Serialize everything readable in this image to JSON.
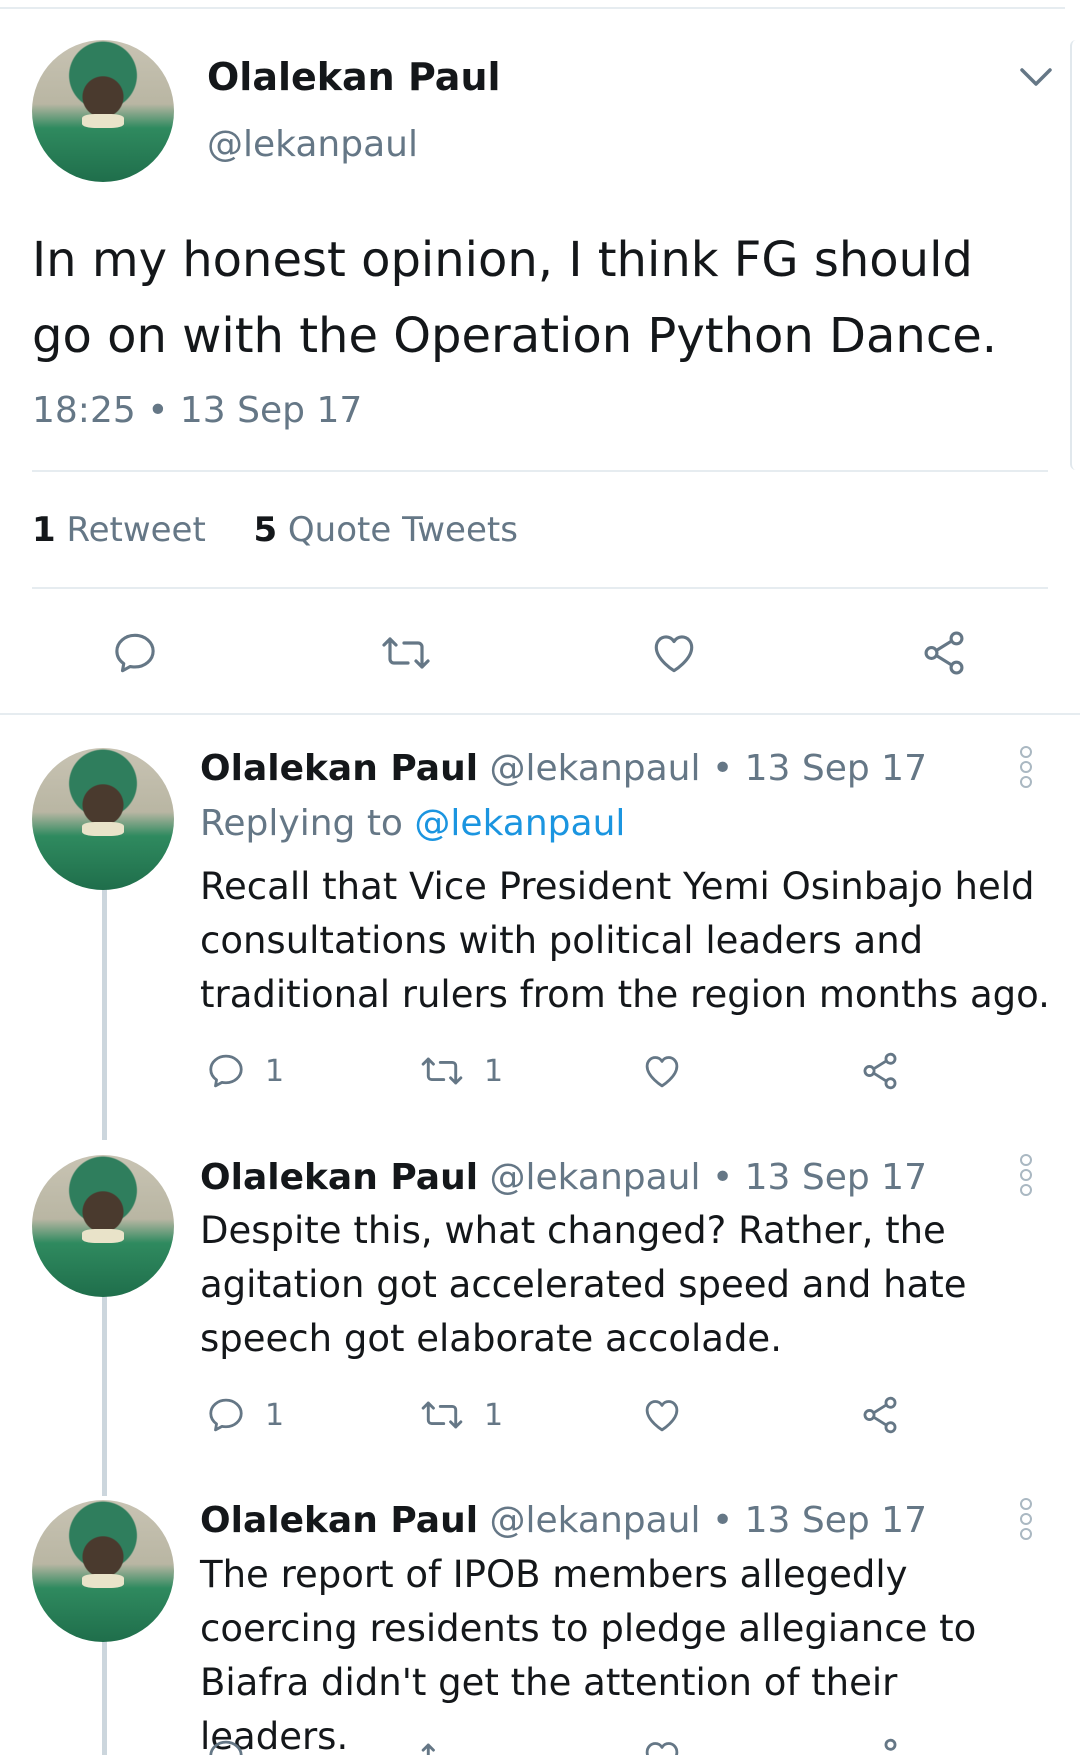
{
  "main_tweet": {
    "author_name": "Olalekan Paul",
    "handle": "@lekanpaul",
    "text": "In my honest opinion, I think FG should go on with the Operation Python Dance.",
    "time": "18:25",
    "date": "13 Sep 17",
    "separator": "•",
    "retweets_count": "1",
    "retweets_label": "Retweet",
    "quotes_count": "5",
    "quotes_label": "Quote Tweets",
    "icons": [
      "reply-icon",
      "retweet-icon",
      "like-icon",
      "share-icon",
      "chevron-down-icon"
    ]
  },
  "replies": [
    {
      "author_name": "Olalekan Paul",
      "meta": "@lekanpaul • 13 Sep 17",
      "replying_to_label": "Replying to",
      "replying_to_handle": "@lekanpaul",
      "text": "Recall that Vice President Yemi Osinbajo held consultations with political leaders and traditional rulers from the region months ago.",
      "reply_count": "1",
      "retweet_count": "1"
    },
    {
      "author_name": "Olalekan Paul",
      "meta": "@lekanpaul • 13 Sep 17",
      "text": "Despite this, what changed? Rather, the agitation got accelerated speed and hate speech got elaborate accolade.",
      "reply_count": "1",
      "retweet_count": "1"
    },
    {
      "author_name": "Olalekan Paul",
      "meta": "@lekanpaul • 13 Sep 17",
      "text": "The report of IPOB members allegedly coercing residents to pledge allegiance to Biafra didn't get the attention of their leaders."
    }
  ],
  "colors": {
    "text": "#14171a",
    "secondary": "#657786",
    "link": "#1b95e0",
    "divider": "#e6ecf0",
    "thread_line": "#ccd6dd"
  }
}
